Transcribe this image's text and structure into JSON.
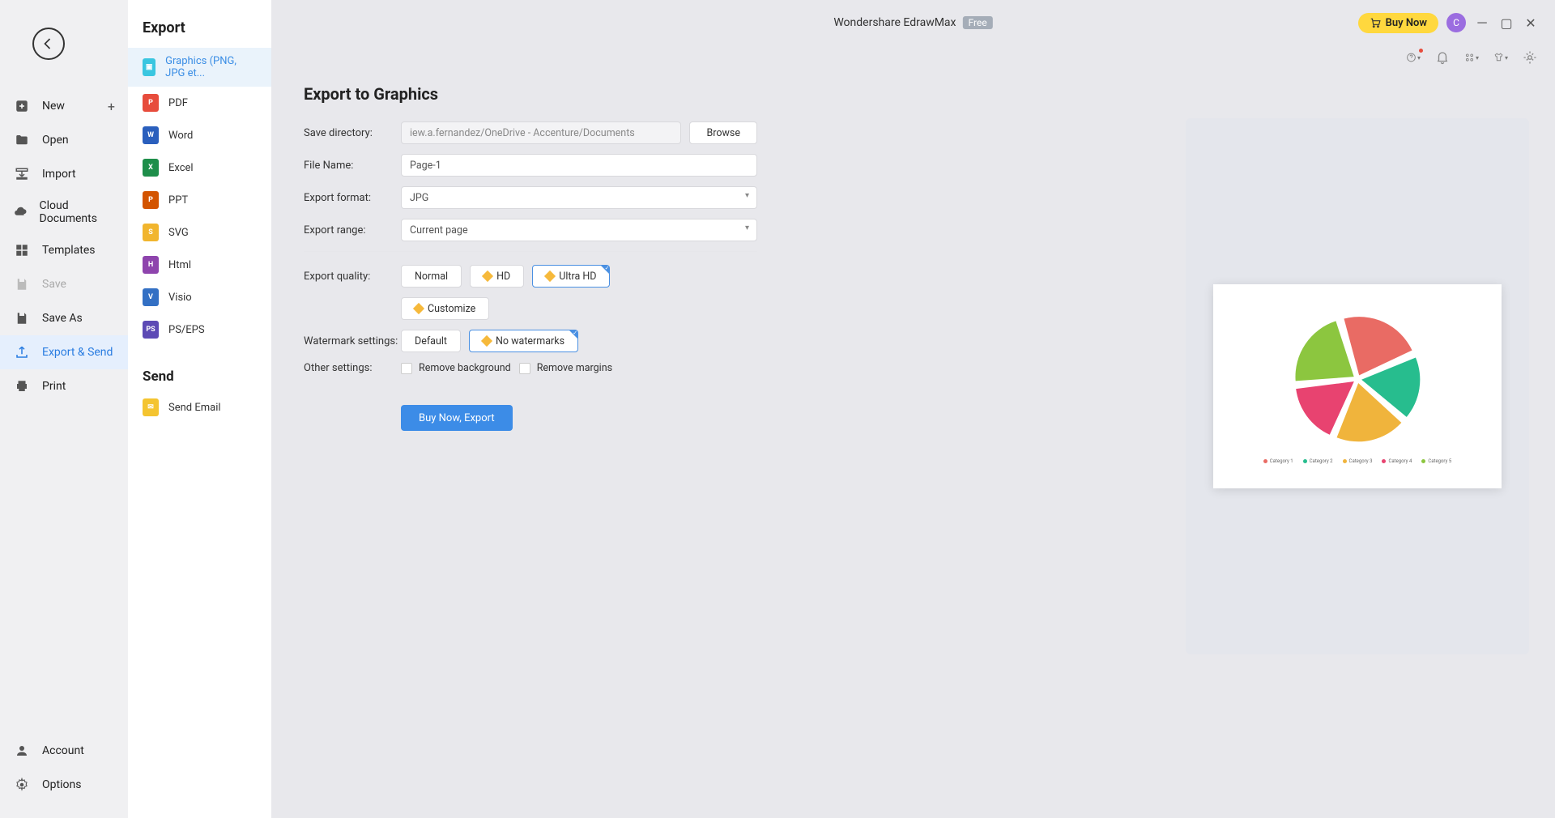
{
  "titlebar": {
    "app_name": "Wondershare EdrawMax",
    "free_badge": "Free",
    "buy_now": "Buy Now",
    "avatar_initial": "C"
  },
  "nav": {
    "new": "New",
    "open": "Open",
    "import": "Import",
    "cloud": "Cloud Documents",
    "templates": "Templates",
    "save": "Save",
    "save_as": "Save As",
    "export_send": "Export & Send",
    "print": "Print",
    "account": "Account",
    "options": "Options"
  },
  "secondary": {
    "export_heading": "Export",
    "send_heading": "Send",
    "items": [
      {
        "label": "Graphics (PNG, JPG et..."
      },
      {
        "label": "PDF"
      },
      {
        "label": "Word"
      },
      {
        "label": "Excel"
      },
      {
        "label": "PPT"
      },
      {
        "label": "SVG"
      },
      {
        "label": "Html"
      },
      {
        "label": "Visio"
      },
      {
        "label": "PS/EPS"
      }
    ],
    "send_email": "Send Email"
  },
  "form": {
    "heading": "Export to Graphics",
    "save_dir_label": "Save directory:",
    "save_dir_value": "iew.a.fernandez/OneDrive - Accenture/Documents",
    "browse": "Browse",
    "file_name_label": "File Name:",
    "file_name_value": "Page-1",
    "format_label": "Export format:",
    "format_value": "JPG",
    "range_label": "Export range:",
    "range_value": "Current page",
    "quality_label": "Export quality:",
    "quality_normal": "Normal",
    "quality_hd": "HD",
    "quality_ultra": "Ultra HD",
    "quality_customize": "Customize",
    "watermark_label": "Watermark settings:",
    "watermark_default": "Default",
    "watermark_none": "No watermarks",
    "other_label": "Other settings:",
    "remove_bg": "Remove background",
    "remove_margins": "Remove margins",
    "export_btn": "Buy Now, Export"
  },
  "chart_data": {
    "type": "pie",
    "title": "",
    "series": [
      {
        "name": "Category 1",
        "value": 23,
        "color": "#e96b64"
      },
      {
        "name": "Category 2",
        "value": 18,
        "color": "#27bd8e"
      },
      {
        "name": "Category 3",
        "value": 20,
        "color": "#f0b43c"
      },
      {
        "name": "Category 4",
        "value": 17,
        "color": "#e84370"
      },
      {
        "name": "Category 5",
        "value": 22,
        "color": "#8cc63f"
      }
    ],
    "legend_labels": [
      "Category 1",
      "Category 2",
      "Category 3",
      "Category 4",
      "Category 5"
    ]
  }
}
